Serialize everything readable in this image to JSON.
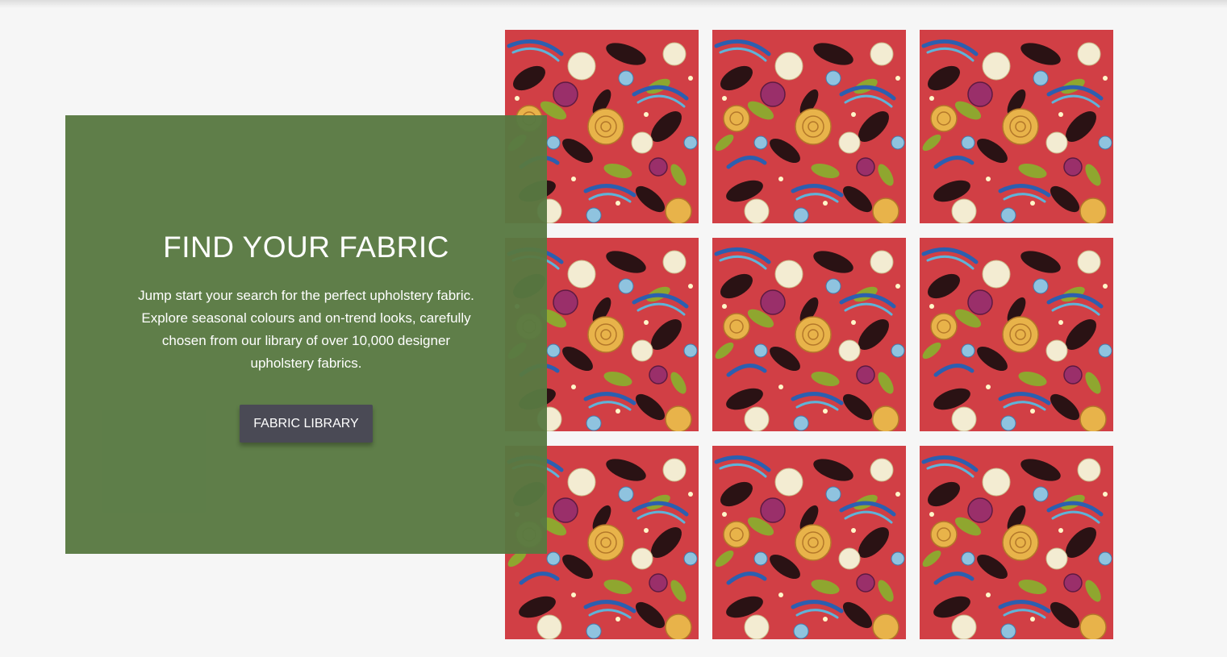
{
  "hero": {
    "title": "FIND YOUR FABRIC",
    "description": "Jump start your search for the perfect upholstery fabric. Explore seasonal colours and on-trend looks, carefully chosen from our library of over 10,000 designer upholstery fabrics.",
    "button_label": "FABRIC LIBRARY"
  },
  "colors": {
    "panel_green": "#5b7b47",
    "button_dark": "#4a4a55",
    "fabric_red": "#d13f45",
    "page_background": "#f6f6f6"
  },
  "fabric_grid": {
    "rows": 3,
    "columns": 3,
    "swatch_icon": "floral-fabric-swatch"
  }
}
